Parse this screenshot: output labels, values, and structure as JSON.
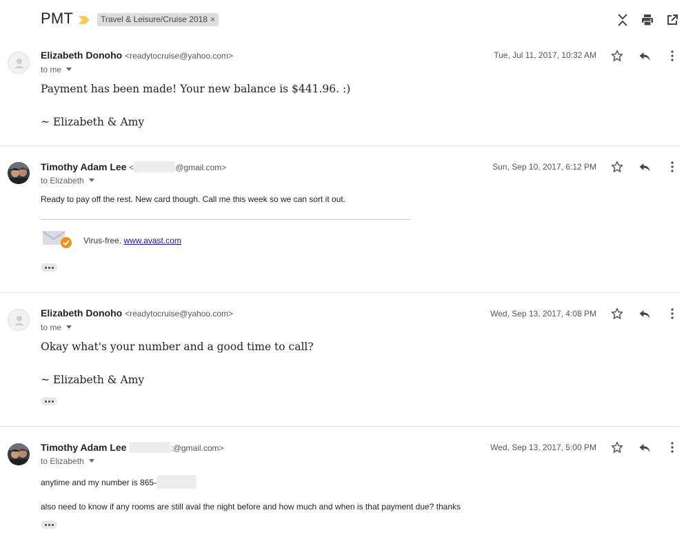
{
  "subject": "PMT",
  "label": "Travel & Leisure/Cruise 2018",
  "label_close": "×",
  "header_icons": [
    "expand-collapse-icon",
    "print-icon",
    "open-in-new-window-icon"
  ],
  "messages": [
    {
      "sender_name": "Elizabeth Donoho",
      "sender_email": "<readytocruise@yahoo.com>",
      "to": "to me",
      "date": "Tue, Jul 11, 2017, 10:32 AM",
      "body_lines": [
        "Payment has been made! Your new balance is $441.96. :)",
        "~ Elizabeth & Amy"
      ]
    },
    {
      "sender_name": "Timothy Adam Lee",
      "sender_email_prefix": "<",
      "sender_email_suffix": "@gmail.com>",
      "to": "to Elizabeth",
      "date": "Sun, Sep 10, 2017, 6:12 PM",
      "body_lines": [
        "Ready to pay off the rest.  New card though.  Call me this week so we can sort it out."
      ],
      "virus_text": "Virus-free. ",
      "virus_link": "www.avast.com"
    },
    {
      "sender_name": "Elizabeth Donoho",
      "sender_email": "<readytocruise@yahoo.com>",
      "to": "to me",
      "date": "Wed, Sep 13, 2017, 4:08 PM",
      "body_lines": [
        "Okay what's your number and a good time to call?",
        "~ Elizabeth & Amy"
      ]
    },
    {
      "sender_name": "Timothy Adam Lee",
      "sender_email_prefix": "",
      "sender_email_suffix": ":@gmail.com>",
      "to": "to Elizabeth",
      "date": "Wed, Sep 13, 2017, 5:00 PM",
      "body_lines": [
        "anytime and my number is 865-",
        "also need to know if any rooms are still aval the night before and how much and when is that payment due? thanks"
      ]
    }
  ],
  "colors": {
    "importance_marker": "#f4cd5b",
    "link": "#1a0dab",
    "divider": "#e5e5e5",
    "badge_orange": "#f28c1c"
  }
}
